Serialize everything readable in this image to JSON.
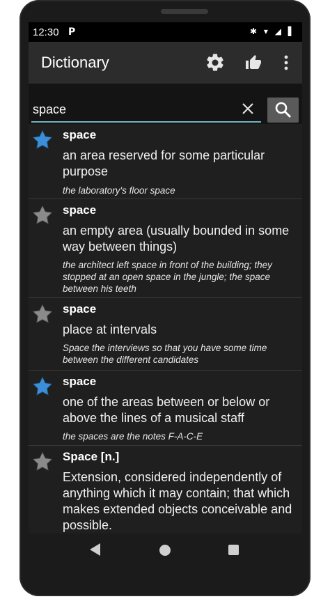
{
  "status_bar": {
    "time": "12:30",
    "app_icon": "P",
    "icons": "✱ ▾ ◢ ▌"
  },
  "app_bar": {
    "title": "Dictionary",
    "icons": [
      "gear-icon",
      "thumbs-up-icon",
      "more-vert-icon"
    ]
  },
  "search": {
    "value": "space",
    "clear_icon": "close-icon",
    "button_icon": "search-icon"
  },
  "colors": {
    "star_active": "#3a8fd8",
    "star_inactive": "#8a8a8a",
    "search_underline": "#73b3bf"
  },
  "entries": [
    {
      "word": "space",
      "starred": true,
      "definition": "an area reserved for some particular purpose",
      "example": "the laboratory's floor space"
    },
    {
      "word": "space",
      "starred": false,
      "definition": "an empty area (usually bounded in some way between things)",
      "example": "the architect left space in front of the building; they stopped at an open space in the jungle; the space between his teeth"
    },
    {
      "word": "space",
      "starred": false,
      "definition": "place at intervals",
      "example": "Space the interviews so that you have some time between the different candidates"
    },
    {
      "word": "space",
      "starred": true,
      "definition": "one of the areas between or below or above the lines of a musical staff",
      "example": "the spaces are the notes F-A-C-E"
    },
    {
      "word": "Space [n.]",
      "starred": false,
      "definition": "Extension, considered independently of anything which it may contain; that which makes extended objects conceivable and possible.",
      "example": ""
    }
  ]
}
